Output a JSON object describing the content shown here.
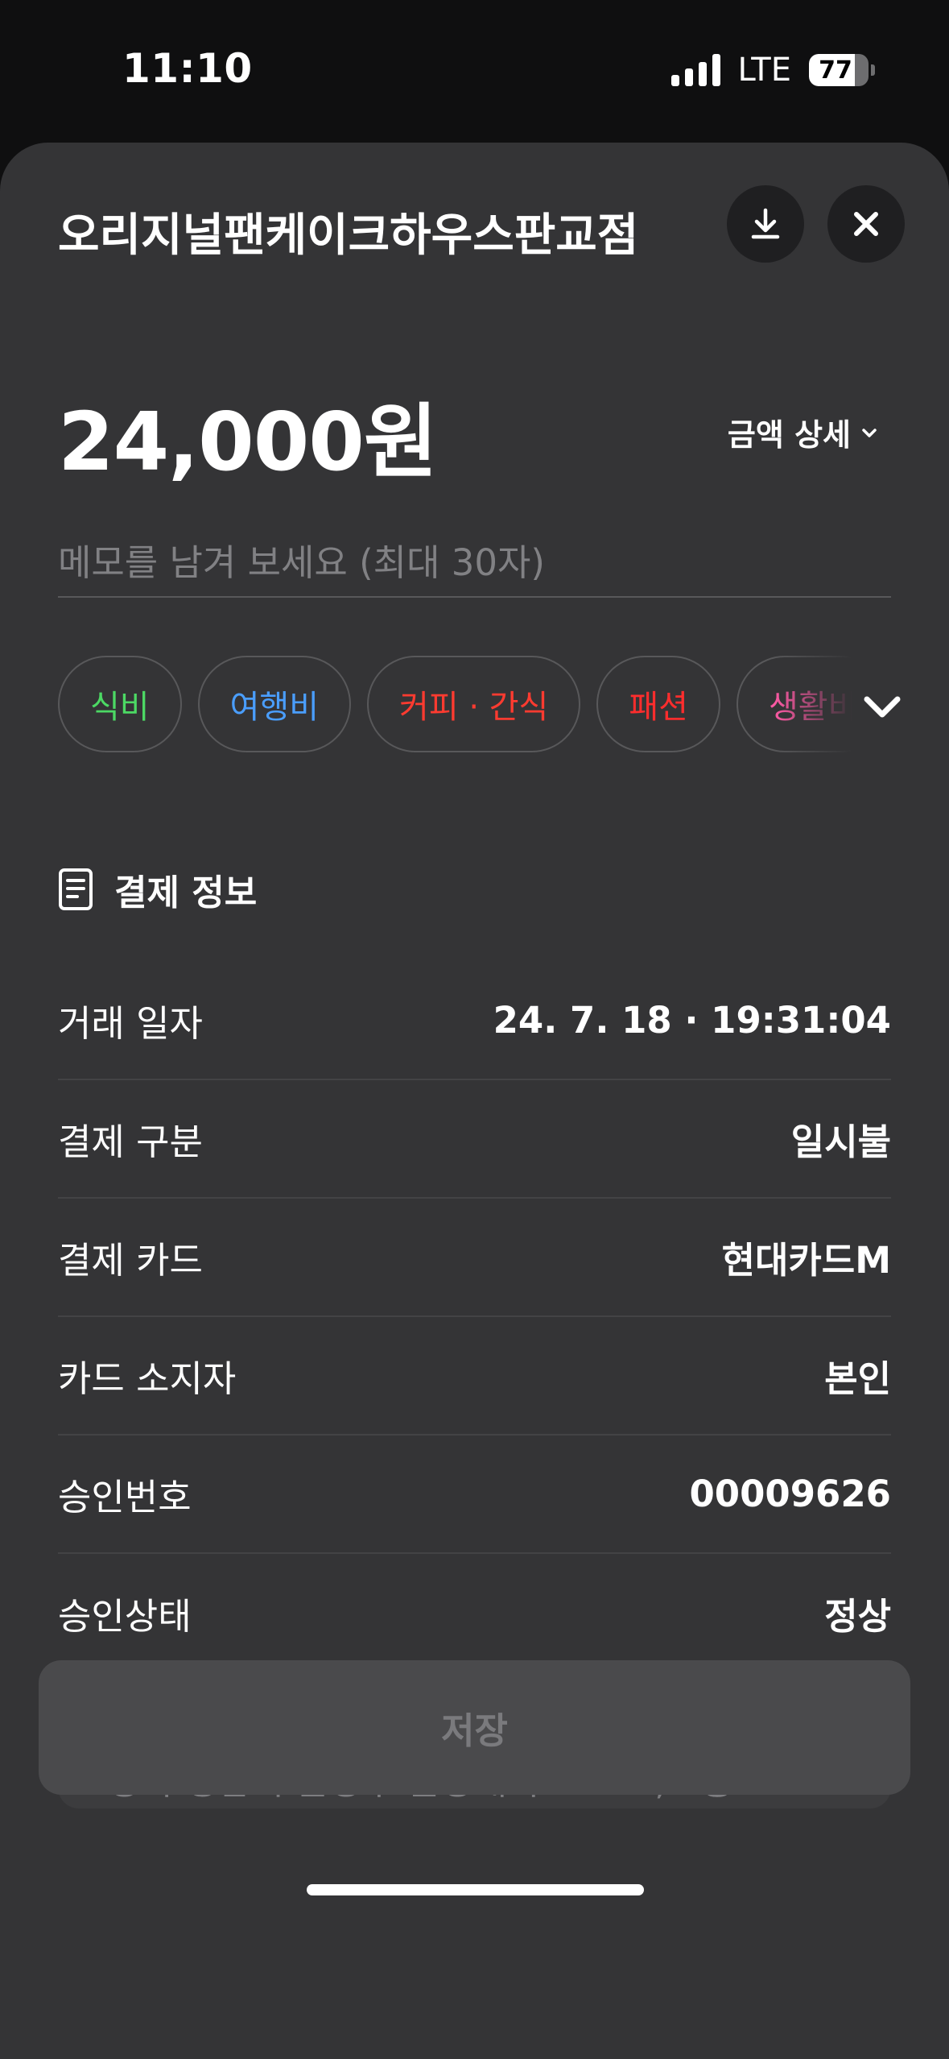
{
  "status_bar": {
    "time": "11:10",
    "network": "LTE",
    "battery": "77",
    "battery_level": 0.77
  },
  "header": {
    "merchant_name": "오리지널팬케이크하우스판교점",
    "download_icon": "download-icon",
    "close_icon": "close-icon"
  },
  "amount": {
    "value": "24,000원",
    "detail_label": "금액 상세"
  },
  "memo": {
    "placeholder": "메모를 남겨 보세요 (최대 30자)",
    "value": ""
  },
  "categories": [
    {
      "label": "식비",
      "color": "#4cd964"
    },
    {
      "label": "여행비",
      "color": "#4a9eff"
    },
    {
      "label": "커피 · 간식",
      "color": "#ff3b30"
    },
    {
      "label": "패션",
      "color": "#ff2d2d"
    },
    {
      "label": "생활비",
      "color": "#ff5aa5"
    }
  ],
  "payment_info": {
    "title": "결제 정보",
    "rows": [
      {
        "label": "거래 일자",
        "value": "24. 7. 18 · 19:31:04"
      },
      {
        "label": "결제 구분",
        "value": "일시불"
      },
      {
        "label": "결제 카드",
        "value": "현대카드M"
      },
      {
        "label": "카드 소지자",
        "value": "본인"
      },
      {
        "label": "승인번호",
        "value": "00009626"
      },
      {
        "label": "승인상태",
        "value": "정상"
      }
    ]
  },
  "address": "경기 성남시 분당구 분당내곡로 131, 1층 5-1호",
  "save_label": "저장",
  "colors": {
    "sheet_bg": "#343436",
    "screen_bg": "#0f0f10",
    "divider": "#434345",
    "button_disabled": "#4a4a4c"
  }
}
